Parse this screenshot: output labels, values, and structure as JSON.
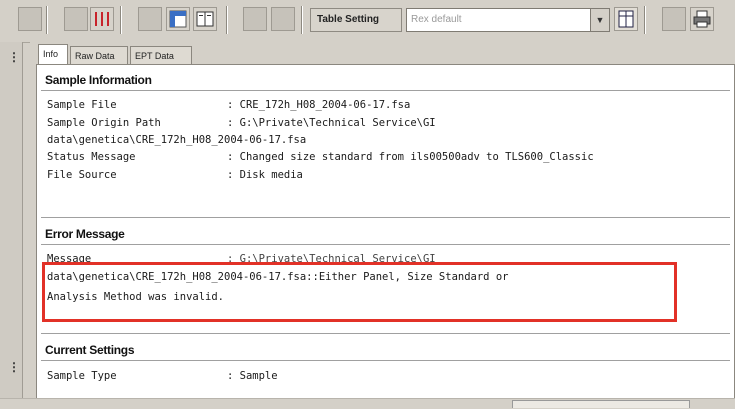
{
  "toolbar": {
    "table_setting_label": "Table Setting",
    "combo_value": "Rex default"
  },
  "tabs": [
    "Info",
    "Raw Data",
    "EPT Data"
  ],
  "sample_information": {
    "heading": "Sample Information",
    "rows": [
      {
        "key": "Sample File",
        "value": ": CRE_172h_H08_2004-06-17.fsa"
      },
      {
        "key": "Sample Origin Path",
        "value": ": G:\\Private\\Technical Service\\GI"
      },
      {
        "key": "data\\genetica\\CRE_172h_H08_2004-06-17.fsa",
        "value": ""
      },
      {
        "key": "Status Message",
        "value": ": Changed size standard from ils00500adv to TLS600_Classic"
      },
      {
        "key": "File Source",
        "value": ": Disk media"
      }
    ]
  },
  "error_message": {
    "heading": "Error Message",
    "message_key": "Message",
    "message_value": ": G:\\Private\\Technical Service\\GI",
    "line1": "data\\genetica\\CRE_172h_H08_2004-06-17.fsa::Either Panel, Size Standard or",
    "line2": "Analysis Method was invalid."
  },
  "current_settings": {
    "heading": "Current Settings",
    "rows": [
      {
        "key": "Sample Type",
        "value": ": Sample"
      }
    ]
  },
  "colors": {
    "highlight": "#e23127",
    "window_bg": "#d4d0c8"
  }
}
